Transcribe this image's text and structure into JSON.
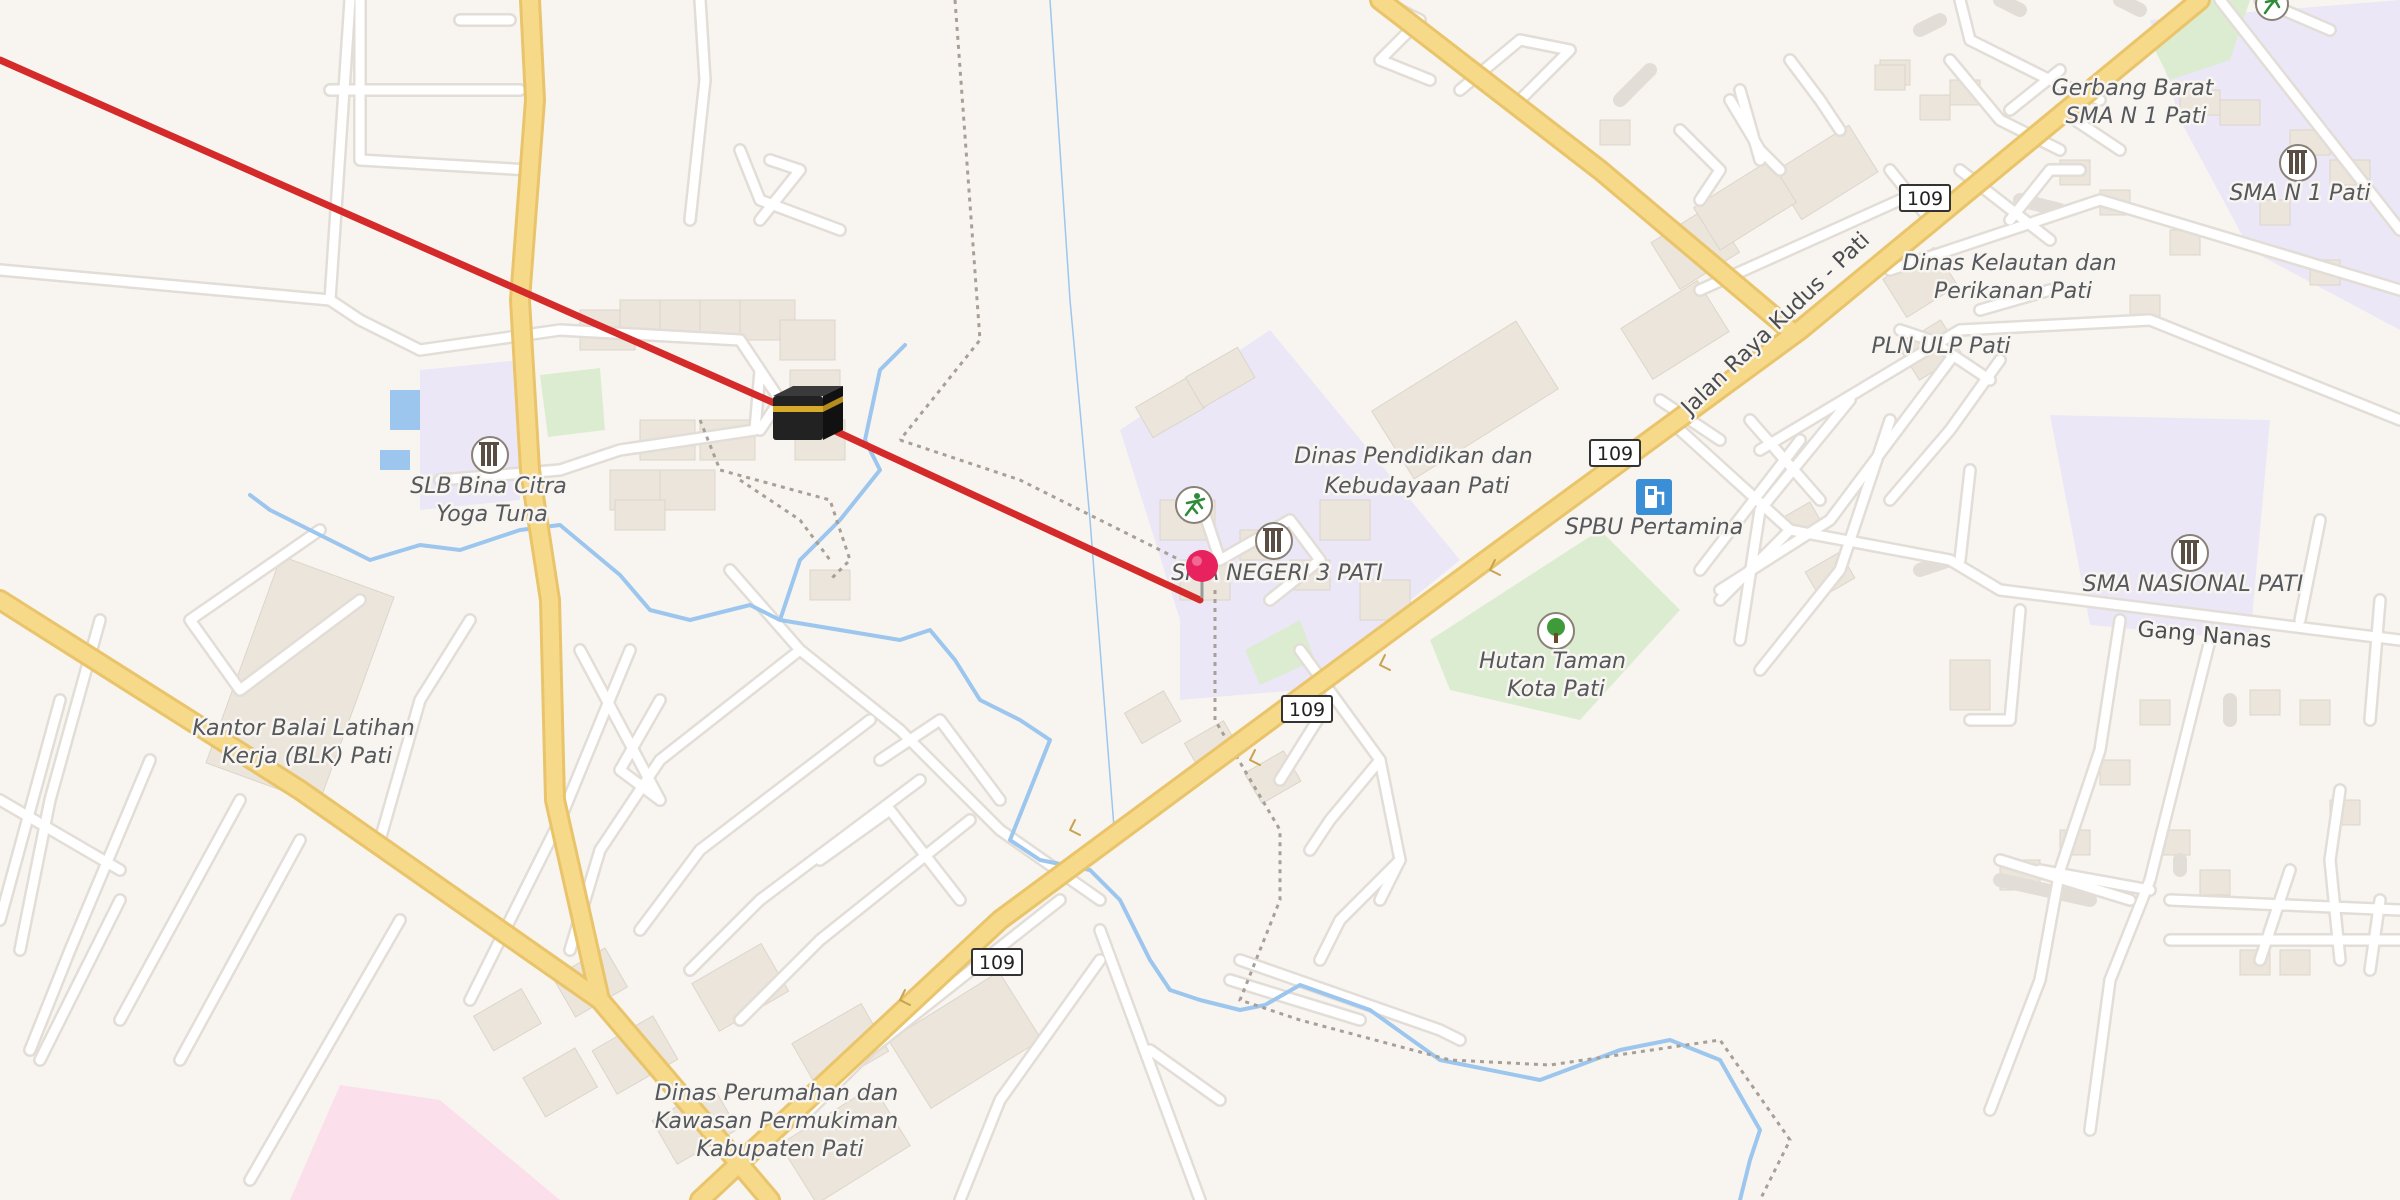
{
  "map": {
    "colors": {
      "background": "#f8f5f0",
      "minor_road": "#ffffff",
      "minor_road_casing": "#e2ddd6",
      "major_road": "#f7d98a",
      "major_road_casing": "#e9c46a",
      "water": "#9cc6ee",
      "building": "#ebe5dc",
      "education_area": "#ece7f7",
      "park": "#dcecd0",
      "route_line": "#d42a2a",
      "pin": "#e8215f"
    },
    "road_shields": [
      "109",
      "109",
      "109",
      "109"
    ],
    "streets": [
      "Jalan Raya Kudus - Pati",
      "Gang Nanas"
    ],
    "places": [
      {
        "name": "slb-bina-citra",
        "lines": [
          "SLB Bina Citra",
          "Yoga Tuna"
        ],
        "icon": "school-icon"
      },
      {
        "name": "kantor-balai-latihan",
        "lines": [
          "Kantor Balai Latihan",
          "Kerja (BLK) Pati"
        ],
        "icon": ""
      },
      {
        "name": "dinas-pendidikan",
        "lines": [
          "Dinas Pendidikan dan",
          "Kebudayaan Pati"
        ],
        "icon": ""
      },
      {
        "name": "sma-negeri-3-pati",
        "lines": [
          "SMA NEGERI 3 PATI"
        ],
        "icon": "school-icon"
      },
      {
        "name": "spbu-pertamina",
        "lines": [
          "SPBU Pertamina"
        ],
        "icon": "fuel-icon"
      },
      {
        "name": "hutan-taman",
        "lines": [
          "Hutan Taman",
          "Kota Pati"
        ],
        "icon": "tree-icon"
      },
      {
        "name": "gerbang-barat",
        "lines": [
          "Gerbang Barat",
          "SMA N 1 Pati"
        ],
        "icon": ""
      },
      {
        "name": "sma-n-1-pati",
        "lines": [
          "SMA N 1 Pati"
        ],
        "icon": "school-icon"
      },
      {
        "name": "dinas-kelautan",
        "lines": [
          "Dinas Kelautan dan",
          "Perikanan Pati"
        ],
        "icon": ""
      },
      {
        "name": "pln-ulp-pati",
        "lines": [
          "PLN ULP Pati"
        ],
        "icon": ""
      },
      {
        "name": "sma-nasional-pati",
        "lines": [
          "SMA NASIONAL PATI"
        ],
        "icon": "school-icon"
      },
      {
        "name": "dinas-perumahan",
        "lines": [
          "Dinas Perumahan dan",
          "Kawasan Permukiman",
          "Kabupaten Pati"
        ],
        "icon": ""
      }
    ],
    "markers": {
      "pin": "location-pin-icon",
      "kaaba": "kaaba-icon",
      "sports": "sports-icon"
    }
  }
}
